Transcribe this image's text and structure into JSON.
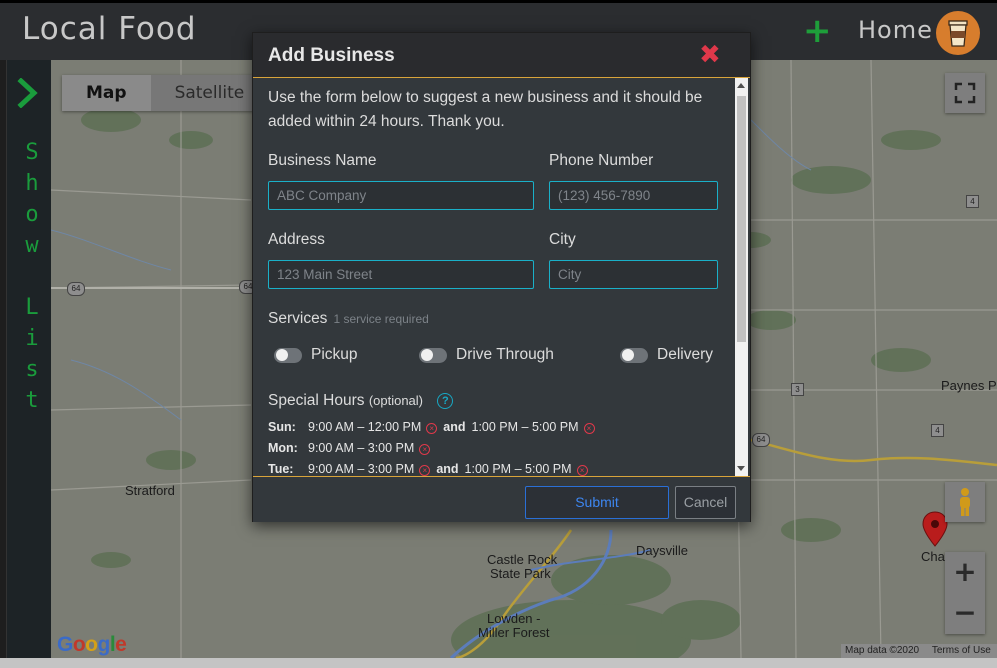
{
  "header": {
    "brand": "Local Food",
    "add_icon": "plus-icon",
    "home_label": "Home",
    "avatar_icon": "coffee-cup-icon"
  },
  "sidebar": {
    "toggle_icon": "chevron-right-icon",
    "label_chars": [
      "S",
      "h",
      "o",
      "w",
      "",
      "L",
      "i",
      "s",
      "t"
    ]
  },
  "map": {
    "tabs": [
      {
        "label": "Map",
        "active": true
      },
      {
        "label": "Satellite",
        "active": false
      }
    ],
    "labels": {
      "stratford": "Stratford",
      "castle_rock": "Castle Rock",
      "castle_rock2": "State Park",
      "lowden": "Lowden -",
      "lowden2": "Miller Forest",
      "daysville": "Daysville",
      "paynes": "Paynes P",
      "chana": "Cha"
    },
    "highways": {
      "h64a": "64",
      "h64b": "64",
      "h64c": "64",
      "s4a": "4",
      "s4b": "4",
      "s3": "3"
    },
    "logo": "Google",
    "attribution": {
      "data": "Map data ©2020",
      "terms": "Terms of Use"
    },
    "controls": {
      "fullscreen": "fullscreen-icon",
      "pegman": "pegman-icon",
      "zoom_in": "+",
      "zoom_out": "−"
    }
  },
  "modal": {
    "title": "Add Business",
    "close": "✖",
    "intro": "Use the form below to suggest a new business and it should be added within 24 hours. Thank you.",
    "fields": {
      "business_name": {
        "label": "Business Name",
        "placeholder": "ABC Company"
      },
      "phone": {
        "label": "Phone Number",
        "placeholder": "(123) 456-7890"
      },
      "address": {
        "label": "Address",
        "placeholder": "123 Main Street"
      },
      "city": {
        "label": "City",
        "placeholder": "City"
      }
    },
    "services": {
      "label": "Services",
      "note": "1 service required",
      "items": [
        "Pickup",
        "Drive Through",
        "Delivery"
      ]
    },
    "special_hours": {
      "label": "Special Hours",
      "note": "(optional)",
      "help": "?",
      "rows": [
        {
          "day": "Sun:",
          "r1": "9:00 AM – 12:00 PM",
          "and": "and",
          "r2": "1:00 PM – 5:00 PM"
        },
        {
          "day": "Mon:",
          "r1": "9:00 AM – 3:00 PM"
        },
        {
          "day": "Tue:",
          "r1": "9:00 AM – 3:00 PM",
          "and": "and",
          "r2": "1:00 PM – 5:00 PM"
        }
      ]
    },
    "buttons": {
      "submit": "Submit",
      "cancel": "Cancel"
    }
  },
  "colors": {
    "accent_green": "#1e9e3a",
    "close_red": "#e0384a",
    "input_border": "#1ab0c8",
    "submit_blue": "#2a6fd6",
    "divider_gold": "#d9a43a"
  }
}
